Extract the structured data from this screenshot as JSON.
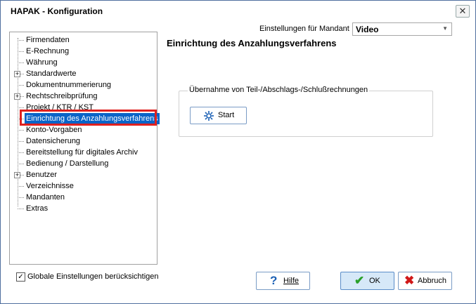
{
  "window": {
    "title": "HAPAK - Konfiguration",
    "close_glyph": "✕"
  },
  "mandant": {
    "label": "Einstellungen für Mandant",
    "value": "Video",
    "arrow_glyph": "▼"
  },
  "page": {
    "title": "Einrichtung des Anzahlungsverfahrens"
  },
  "group": {
    "legend": "Übernahme von Teil-/Abschlags-/Schlußrechnungen",
    "start_label": "Start"
  },
  "tree": {
    "items": [
      {
        "label": "Firmendaten",
        "expandable": false
      },
      {
        "label": "E-Rechnung",
        "expandable": false
      },
      {
        "label": "Währung",
        "expandable": false
      },
      {
        "label": "Standardwerte",
        "expandable": true
      },
      {
        "label": "Dokumentnummerierung",
        "expandable": false
      },
      {
        "label": "Rechtschreibprüfung",
        "expandable": true
      },
      {
        "label": "Projekt / KTR / KST",
        "expandable": false
      },
      {
        "label": "Einrichtung des Anzahlungsverfahrens",
        "expandable": false,
        "selected": true
      },
      {
        "label": "Konto-Vorgaben",
        "expandable": false
      },
      {
        "label": "Datensicherung",
        "expandable": false
      },
      {
        "label": "Bereitstellung für digitales Archiv",
        "expandable": false
      },
      {
        "label": "Bedienung / Darstellung",
        "expandable": false
      },
      {
        "label": "Benutzer",
        "expandable": true
      },
      {
        "label": "Verzeichnisse",
        "expandable": false
      },
      {
        "label": "Mandanten",
        "expandable": false
      },
      {
        "label": "Extras",
        "expandable": false
      }
    ]
  },
  "footer": {
    "global_settings_label": "Globale Einstellungen berücksichtigen",
    "global_settings_checked": true,
    "help_label": "Hilfe",
    "ok_label": "OK",
    "cancel_label": "Abbruch"
  },
  "colors": {
    "selection": "#0a64c8",
    "highlight_border": "#e0201e",
    "ok_check": "#2aa02a",
    "cancel_x": "#d01818",
    "help_icon": "#1a5fb4"
  }
}
